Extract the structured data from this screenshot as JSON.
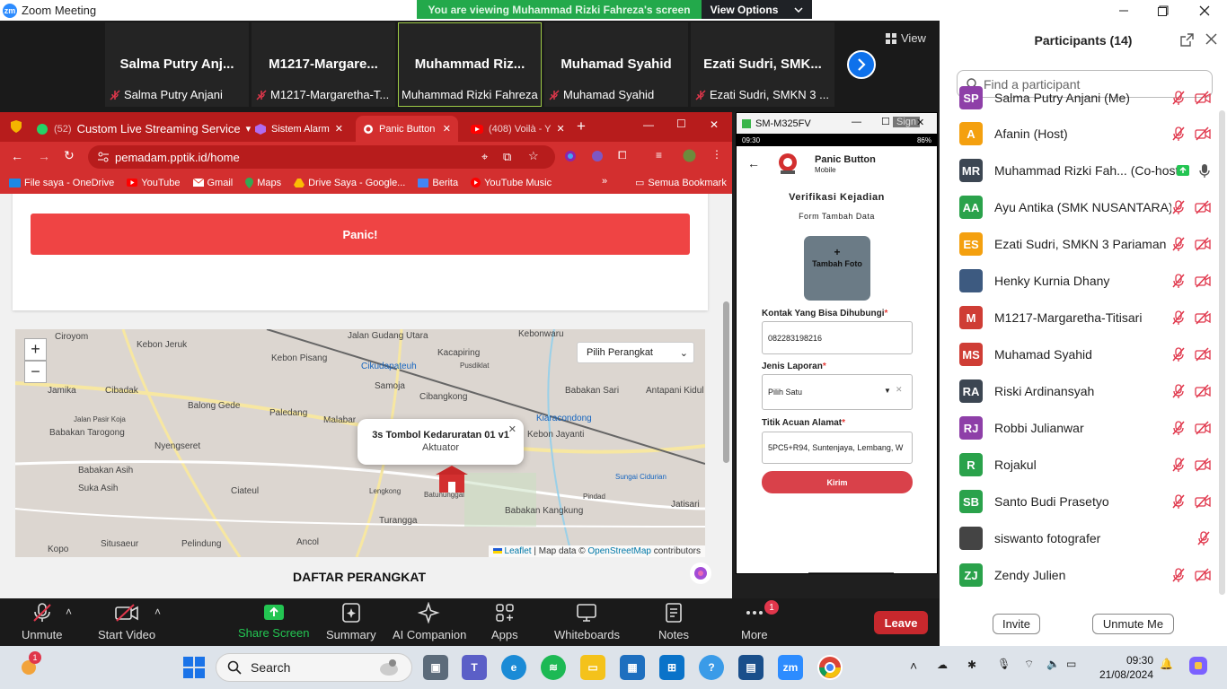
{
  "window": {
    "title": "Zoom Meeting",
    "logo_text": "zm"
  },
  "banner": {
    "viewing": "You are viewing Muhammad Rizki Fahreza's screen",
    "options": "View Options"
  },
  "strip": {
    "tiles": [
      {
        "name": "Salma  Putry  Anj...",
        "label": "Salma Putry Anjani",
        "muted": true
      },
      {
        "name": "M1217-Margare...",
        "label": "M1217-Margaretha-T...",
        "muted": true
      },
      {
        "name": "Muhammad  Riz...",
        "label": "Muhammad Rizki Fahreza",
        "muted": false
      },
      {
        "name": "Muhamad Syahid",
        "label": "Muhamad Syahid",
        "muted": true
      },
      {
        "name": "Ezati Sudri,  SMK...",
        "label": "Ezati Sudri, SMKN 3 ...",
        "muted": true
      }
    ],
    "view_label": "View"
  },
  "chrome": {
    "tabs": [
      {
        "label": "Custom Live Streaming Service",
        "prefix": "(52)"
      },
      {
        "label": "Sistem Alarm"
      },
      {
        "label": "Panic Button"
      },
      {
        "label": "(408) Voilà - Y"
      }
    ],
    "url": "pemadam.pptik.id/home",
    "bookmarks": [
      "File saya - OneDrive",
      "YouTube",
      "Gmail",
      "Maps",
      "Drive Saya - Google...",
      "Berita",
      "YouTube Music"
    ],
    "all_bookmarks": "Semua Bookmark"
  },
  "page": {
    "panic_label": "Panic!",
    "device_select": "Pilih Perangkat",
    "popup_title": "3s Tombol Kedaruratan 01 v1",
    "popup_sub": "Aktuator",
    "attribution_leaflet": "Leaflet",
    "attribution_text": "| Map data ©",
    "attribution_osm": "OpenStreetMap",
    "attribution_tail": "contributors",
    "daftar": "DAFTAR PERANGKAT",
    "map_labels": [
      "Ciroyom",
      "Kebon Jeruk",
      "Kebon Pisang",
      "Jalan Gudang Utara",
      "Cikudapateuh",
      "Kacapiring",
      "Pusdiklat",
      "Kebonwaru",
      "Jamika",
      "Cibadak",
      "Samoja",
      "Cibangkong",
      "Babakan Sari",
      "Antapani Kidul",
      "Balong Gede",
      "Paledang",
      "Malabar",
      "Kiaracondong",
      "Babakan Tarogong",
      "Nyengseret",
      "Kebon Jayanti",
      "Babakan Asih",
      "Suka Asih",
      "Ciateul",
      "Lengkong",
      "Pindad",
      "Sungai Cidurian",
      "Batununggal",
      "Babakan Kangkung",
      "Jatisari",
      "Kopo",
      "Situsaeur",
      "Pelindung",
      "Ancol",
      "Turangga",
      "Jalan Pasir Koja"
    ]
  },
  "phone": {
    "title": "SM-M325FV",
    "time": "09:30",
    "battery": "86%",
    "sign": "Sign",
    "app_name": "Panic Button",
    "app_sub": "Mobile",
    "heading": "Verifikasi Kejadian",
    "subheading": "Form Tambah Data",
    "photo_label": "Tambah Foto",
    "contact_label": "Kontak Yang Bisa Dihubungi",
    "contact_value": "082283198216",
    "report_label": "Jenis Laporan",
    "report_value": "Pilih Satu",
    "address_label": "Titik Acuan Alamat",
    "address_value": "5PC5+R94, Suntenjaya, Lembang, W",
    "submit": "Kirim"
  },
  "participants": {
    "title": "Participants (14)",
    "search_placeholder": "Find a participant",
    "list": [
      {
        "initials": "SP",
        "name": "Salma Putry Anjani (Me)",
        "color": "#8e3fa8"
      },
      {
        "initials": "A",
        "name": "Afanin (Host)",
        "color": "#f4a00f"
      },
      {
        "initials": "MR",
        "name": "Muhammad Rizki Fah... (Co-host)",
        "color": "#3c4652"
      },
      {
        "initials": "AA",
        "name": "Ayu Antika (SMK NUSANTARA)",
        "color": "#2aa24b"
      },
      {
        "initials": "ES",
        "name": "Ezati Sudri, SMKN 3 Pariaman",
        "color": "#f4a00f"
      },
      {
        "initials": "",
        "name": "Henky Kurnia Dhany",
        "color": "#3d5a80"
      },
      {
        "initials": "M",
        "name": "M1217-Margaretha-Titisari",
        "color": "#cf3d35"
      },
      {
        "initials": "MS",
        "name": "Muhamad Syahid",
        "color": "#cf3d35"
      },
      {
        "initials": "RA",
        "name": "Riski Ardinansyah",
        "color": "#3c4652"
      },
      {
        "initials": "RJ",
        "name": "Robbi Julianwar",
        "color": "#8e3fa8"
      },
      {
        "initials": "R",
        "name": "Rojakul",
        "color": "#2aa24b"
      },
      {
        "initials": "SB",
        "name": "Santo Budi Prasetyo",
        "color": "#2aa24b"
      },
      {
        "initials": "",
        "name": "siswanto fotografer",
        "color": "#444444"
      },
      {
        "initials": "ZJ",
        "name": "Zendy Julien",
        "color": "#2aa24b"
      }
    ],
    "invite": "Invite",
    "unmute_me": "Unmute Me"
  },
  "toolbar": {
    "unmute": "Unmute",
    "start_video": "Start Video",
    "share_screen": "Share Screen",
    "summary": "Summary",
    "ai_companion": "AI Companion",
    "apps": "Apps",
    "whiteboards": "Whiteboards",
    "notes": "Notes",
    "more": "More",
    "more_badge": "1",
    "leave": "Leave"
  },
  "taskbar": {
    "search": "Search",
    "time": "09:30",
    "date": "21/08/2024",
    "weather_badge": "1"
  }
}
